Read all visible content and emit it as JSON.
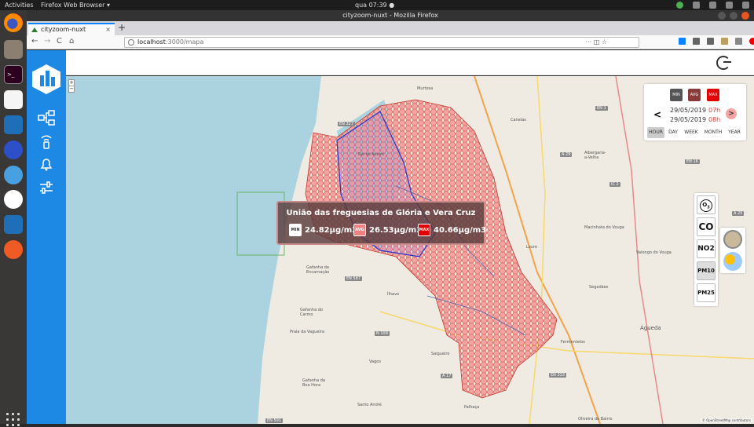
{
  "topbar": {
    "activities": "Activities",
    "app_menu": "Firefox Web Browser ▾",
    "clock": "qua 07:39 ●"
  },
  "window": {
    "title": "cityzoom-nuxt - Mozilla Firefox"
  },
  "browser": {
    "tab_title": "cityzoom-nuxt",
    "tab_close": "×",
    "new_tab": "+",
    "url_host": "localhost",
    "url_path": ":3000/mapa",
    "url_dots": "··· ◫ ☆",
    "back": "←",
    "forward": "→",
    "reload": "C",
    "home": "⌂"
  },
  "sidebar": {
    "items": [
      {
        "icon": "network-icon"
      },
      {
        "icon": "sensor-icon"
      },
      {
        "icon": "bell-icon"
      },
      {
        "icon": "sliders-icon"
      }
    ]
  },
  "map": {
    "zoom_in": "+",
    "zoom_out": "−",
    "labels": {
      "murtosa": "Murtosa",
      "canelas": "Canelas",
      "albergaria": "Albergaria-\na-Velha",
      "ria_aveiro": "Ria de Aveiro",
      "ilhavo": "Ílhavo",
      "gafanha_encarnacao": "Gafanha da\nEncarnação",
      "gafanha_carmo": "Gafanha do\nCarmo",
      "praia_vagueira": "Praia da Vagueira",
      "gafanha_boa_hora": "Gafanha da\nBoa Hora",
      "vagos": "Vagos",
      "salgueiro": "Salgueiro",
      "santo_andre": "Santo André",
      "palhaca": "Palhaça",
      "oliveira_bairro": "Oliveira do Bairro",
      "agueda": "Águeda",
      "fermentelos": "Fermentelos",
      "segadaes": "Segadães",
      "valongo": "Valongo do Vouga",
      "macinhata": "Macinhata do Vouga",
      "loure": "Loure"
    },
    "roads": {
      "en327": "EN 327",
      "a29": "A 29",
      "a25": "A 25",
      "ic2": "IC 2",
      "en16": "EN 16",
      "en1": "EN 1",
      "a1": "A 1",
      "en333": "EN 333",
      "a17": "A 17",
      "en587": "EN 587",
      "en591": "EN 591",
      "n109": "N 109"
    },
    "attribution": "© OpenStreetMap contributors"
  },
  "tooltip": {
    "title": "União das freguesias de Glória e Vera Cruz",
    "min_label": "MIN",
    "min_value": "24.82µg/m3",
    "avg_label": "AVG",
    "avg_value": "26.53µg/m3",
    "max_label": "MAX",
    "max_value": "40.66µg/m3"
  },
  "date_panel": {
    "toggles": [
      {
        "label": "MIN",
        "color": "#555555"
      },
      {
        "label": "AVG",
        "color": "#8b3a3a"
      },
      {
        "label": "MAX",
        "color": "#e00000"
      }
    ],
    "prev": "<",
    "next": ">",
    "date_from": "29/05/2019",
    "hour_from": "07h",
    "date_to": "29/05/2019",
    "hour_to": "08h",
    "granularity": [
      "HOUR",
      "DAY",
      "WEEK",
      "MONTH",
      "YEAR"
    ],
    "active_granularity": "HOUR"
  },
  "pollutants": {
    "o3_main": "O",
    "o3_sub": "3",
    "co": "CO",
    "no2": "NO2",
    "pm10": "PM10",
    "pm25": "PM25",
    "active": "PM10"
  },
  "colors": {
    "sidebar": "#1e88e5",
    "hexfill": "#f4a3a3",
    "hexstroke": "#c0392b",
    "max_badge": "#e00000"
  }
}
